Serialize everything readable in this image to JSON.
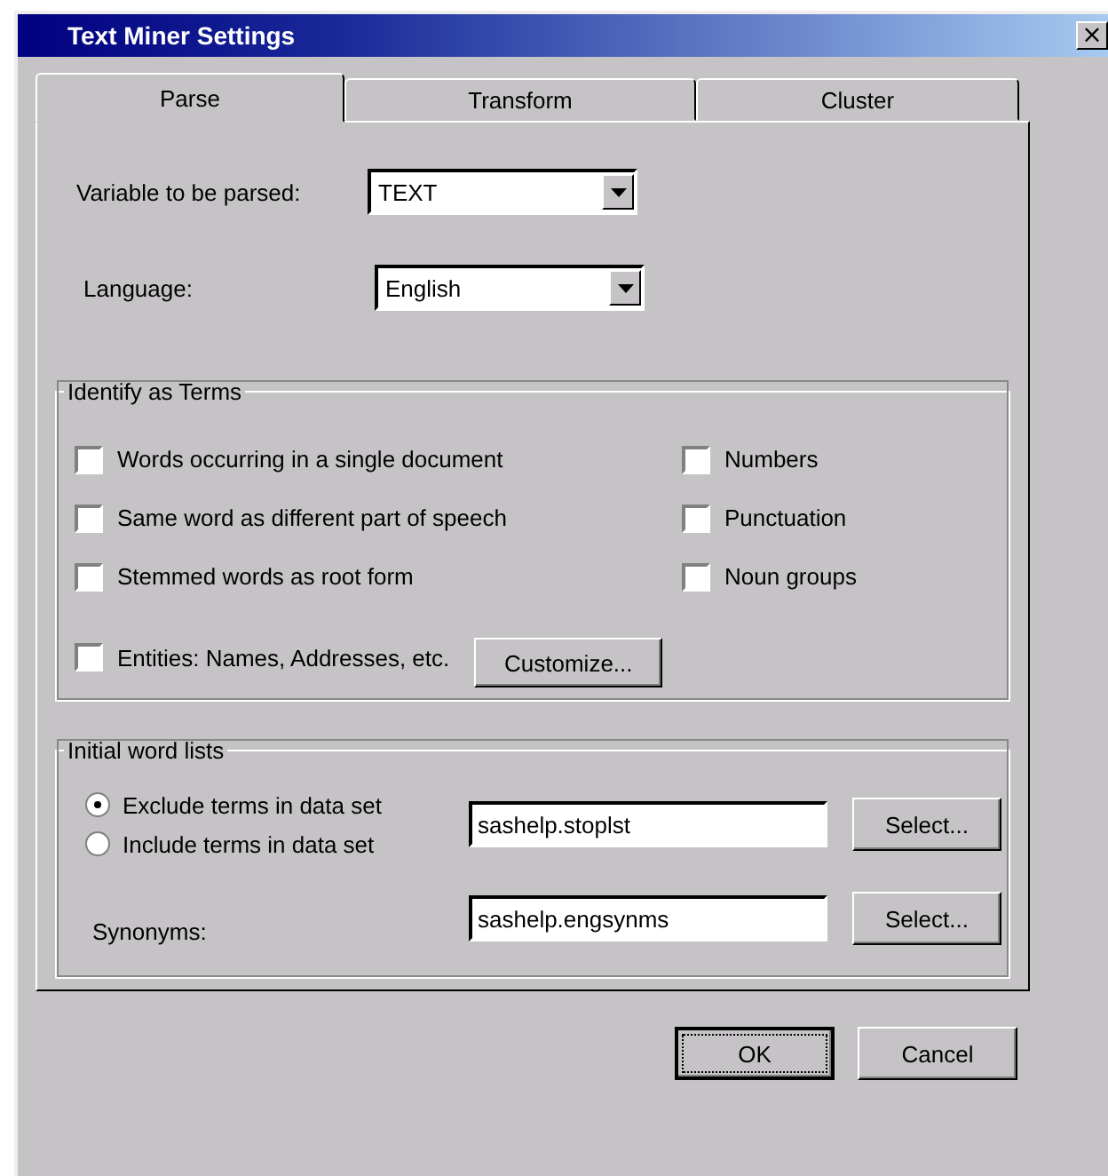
{
  "window": {
    "title": "Text Miner Settings",
    "close_icon": "×"
  },
  "tabs": [
    {
      "label": "Parse",
      "selected": true
    },
    {
      "label": "Transform",
      "selected": false
    },
    {
      "label": "Cluster",
      "selected": false
    }
  ],
  "fields": [
    {
      "label": "Variable to be parsed:",
      "value": "TEXT"
    },
    {
      "label": "Language:",
      "value": "English"
    }
  ],
  "identify_as_terms": {
    "title": "Identify as Terms",
    "left": [
      {
        "label": "Words occurring in a single document",
        "checked": false
      },
      {
        "label": "Same word as different part of speech",
        "checked": false
      },
      {
        "label": "Stemmed words as root form",
        "checked": false
      },
      {
        "label": "Entities: Names, Addresses, etc.",
        "checked": false
      }
    ],
    "right": [
      {
        "label": "Numbers",
        "checked": false
      },
      {
        "label": "Punctuation",
        "checked": false
      },
      {
        "label": "Noun groups",
        "checked": false
      }
    ],
    "customize_button": "Customize..."
  },
  "initial_word_lists": {
    "title": "Initial word lists",
    "radios": [
      {
        "label": "Exclude terms in data set",
        "selected": true
      },
      {
        "label": "Include terms in data set",
        "selected": false
      }
    ],
    "stop_list": {
      "value": "sashelp.stoplst",
      "button": "Select..."
    },
    "synonyms": {
      "label": "Synonyms:",
      "value": "sashelp.engsynms",
      "button": "Select..."
    }
  },
  "buttons": [
    "OK",
    "Cancel"
  ]
}
